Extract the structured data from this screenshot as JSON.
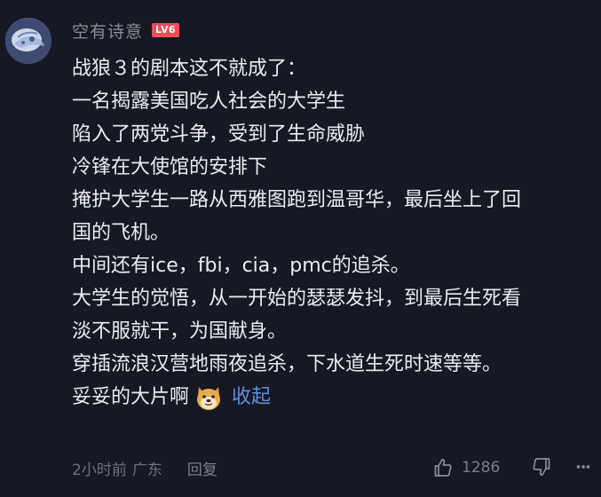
{
  "user": {
    "name": "空有诗意",
    "level_badge": "LV6"
  },
  "comment": {
    "lines": [
      "战狼３的剧本这不就成了：",
      "一名揭露美国吃人社会的大学生",
      "陷入了两党斗争，受到了生命威胁",
      "冷锋在大使馆的安排下",
      "掩护大学生一路从西雅图跑到温哥华，最后坐上了回",
      "国的飞机。",
      "中间还有ice，fbi，cia，pmc的追杀。",
      "大学生的觉悟，从一开始的瑟瑟发抖，到最后生死看",
      "淡不服就干，为国献身。",
      "穿插流浪汉营地雨夜追杀，下水道生死时速等等。"
    ],
    "last_line": "妥妥的大片啊",
    "emoji": "doge-emoji",
    "collapse_label": "收起"
  },
  "footer": {
    "time": "2小时前",
    "location": "广东",
    "reply_label": "回复",
    "like_count": "1286"
  },
  "icons": {
    "like": "thumbs-up-icon",
    "dislike": "thumbs-down-icon",
    "more": "more-icon"
  },
  "colors": {
    "background": "#161823",
    "badge": "#f04b58",
    "link": "#5f8fdc"
  }
}
